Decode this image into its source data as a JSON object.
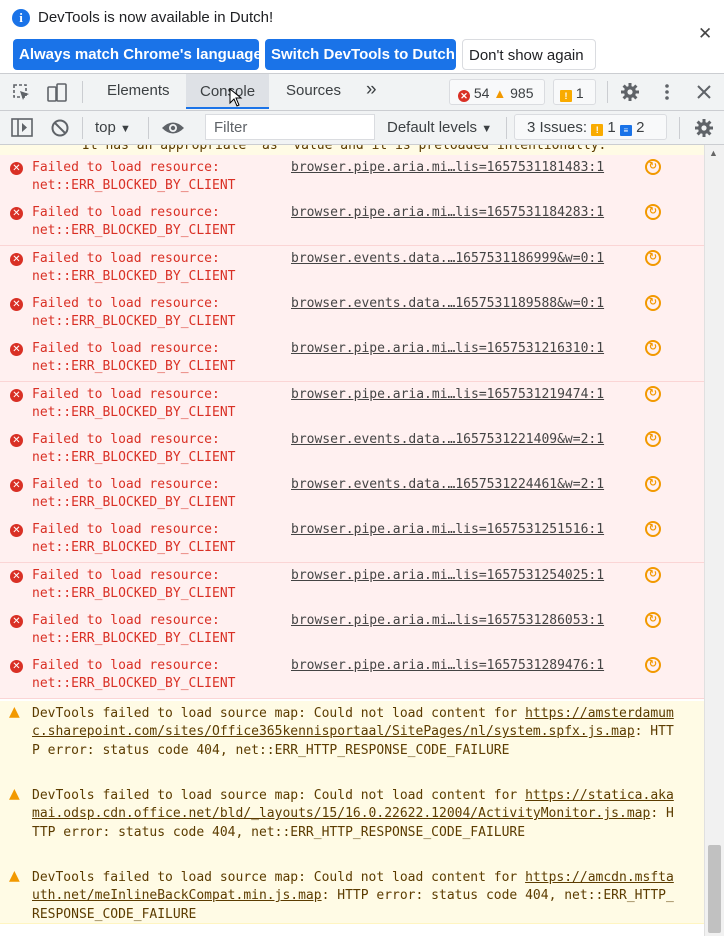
{
  "infobar": {
    "message": "DevTools is now available in Dutch!",
    "btn_match": "Always match Chrome's language",
    "btn_switch": "Switch DevTools to Dutch",
    "btn_dismiss": "Don't show again",
    "close": "✕"
  },
  "tabs": {
    "elements": "Elements",
    "console": "Console",
    "sources": "Sources",
    "more": "»",
    "error_count": "54",
    "warning_count": "985",
    "issue_count": "1"
  },
  "toolbar": {
    "context": "top",
    "filter_placeholder": "Filter",
    "levels": "Default levels",
    "issues_label": "3 Issues:",
    "issues_warn": "1",
    "issues_info": "2"
  },
  "console": {
    "partial_text": "It has an appropriate `as` value and it is preloaded intentionally.",
    "errors": [
      {
        "line1": "Failed to load resource:",
        "line2": "net::ERR_BLOCKED_BY_CLIENT",
        "source": "browser.pipe.aria.mi…lis=1657531181483:1"
      },
      {
        "line1": "Failed to load resource:",
        "line2": "net::ERR_BLOCKED_BY_CLIENT",
        "source": "browser.pipe.aria.mi…lis=1657531184283:1"
      },
      {
        "line1": "Failed to load resource:",
        "line2": "net::ERR_BLOCKED_BY_CLIENT",
        "source": "browser.events.data.…1657531186999&w=0:1"
      },
      {
        "line1": "Failed to load resource:",
        "line2": "net::ERR_BLOCKED_BY_CLIENT",
        "source": "browser.events.data.…1657531189588&w=0:1"
      },
      {
        "line1": "Failed to load resource:",
        "line2": "net::ERR_BLOCKED_BY_CLIENT",
        "source": "browser.pipe.aria.mi…lis=1657531216310:1"
      },
      {
        "line1": "Failed to load resource:",
        "line2": "net::ERR_BLOCKED_BY_CLIENT",
        "source": "browser.pipe.aria.mi…lis=1657531219474:1"
      },
      {
        "line1": "Failed to load resource:",
        "line2": "net::ERR_BLOCKED_BY_CLIENT",
        "source": "browser.events.data.…1657531221409&w=2:1"
      },
      {
        "line1": "Failed to load resource:",
        "line2": "net::ERR_BLOCKED_BY_CLIENT",
        "source": "browser.events.data.…1657531224461&w=2:1"
      },
      {
        "line1": "Failed to load resource:",
        "line2": "net::ERR_BLOCKED_BY_CLIENT",
        "source": "browser.pipe.aria.mi…lis=1657531251516:1"
      },
      {
        "line1": "Failed to load resource:",
        "line2": "net::ERR_BLOCKED_BY_CLIENT",
        "source": "browser.pipe.aria.mi…lis=1657531254025:1"
      },
      {
        "line1": "Failed to load resource:",
        "line2": "net::ERR_BLOCKED_BY_CLIENT",
        "source": "browser.pipe.aria.mi…lis=1657531286053:1"
      },
      {
        "line1": "Failed to load resource:",
        "line2": "net::ERR_BLOCKED_BY_CLIENT",
        "source": "browser.pipe.aria.mi…lis=1657531289476:1"
      }
    ],
    "warnings": [
      {
        "prefix": "DevTools failed to load source map: Could not load content for ",
        "url": "https://amsterdamumc.sharepoint.com/sites/Office365kennisportaal/SitePages/nl/system.spfx.js.map",
        "suffix": ": HTTP error: status code 404, net::ERR_HTTP_RESPONSE_CODE_FAILURE"
      },
      {
        "prefix": "DevTools failed to load source map: Could not load content for ",
        "url": "https://statica.akamai.odsp.cdn.office.net/bld/_layouts/15/16.0.22622.12004/ActivityMonitor.js.map",
        "suffix": ": HTTP error: status code 404, net::ERR_HTTP_RESPONSE_CODE_FAILURE"
      },
      {
        "prefix": "DevTools failed to load source map: Could not load content for ",
        "url": "https://amcdn.msftauth.net/meInlineBackCompat.min.js.map",
        "suffix": ": HTTP error: status code 404, net::ERR_HTTP_RESPONSE_CODE_FAILURE"
      }
    ]
  }
}
